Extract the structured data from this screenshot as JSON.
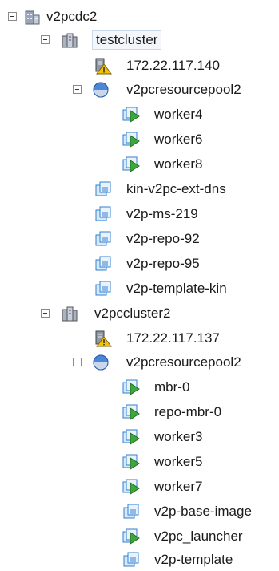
{
  "tree": {
    "datacenter": "v2pcdc2",
    "cluster1": {
      "name": "testcluster",
      "host": "172.22.117.140",
      "pool": "v2pcresourcepool2",
      "pool_vms": [
        "worker4",
        "worker6",
        "worker8"
      ],
      "vms": [
        "kin-v2pc-ext-dns",
        "v2p-ms-219",
        "v2p-repo-92",
        "v2p-repo-95",
        "v2p-template-kin"
      ]
    },
    "cluster2": {
      "name": "v2pccluster2",
      "host": "172.22.117.137",
      "pool": "v2pcresourcepool2",
      "pool_vms": [
        "mbr-0",
        "repo-mbr-0",
        "worker3",
        "worker5",
        "worker7",
        "v2p-base-image",
        "v2pc_launcher",
        "v2p-template"
      ]
    }
  },
  "icons": {
    "datacenter": "datacenter-icon",
    "cluster": "cluster-icon",
    "host_warning": "host-warning-icon",
    "resource_pool": "resource-pool-icon",
    "vm_powered_on": "vm-powered-on-icon",
    "vm": "vm-icon"
  },
  "colors": {
    "selection_border": "#c9d9ea",
    "vm_green": "#3da63d",
    "vm_blue": "#2f7fd0",
    "warning_yellow": "#f2c200"
  }
}
